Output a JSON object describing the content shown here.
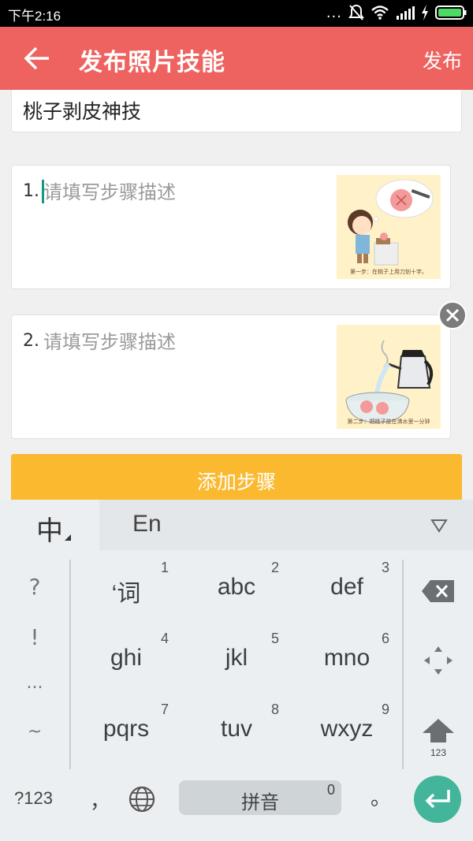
{
  "status_bar": {
    "time": "下午2:16",
    "dots": "...",
    "icons": [
      "mute-icon",
      "wifi-icon",
      "signal-icon",
      "charging-icon",
      "battery-icon"
    ]
  },
  "app_bar": {
    "title": "发布照片技能",
    "publish_label": "发布",
    "back_icon": "back-arrow-icon"
  },
  "skill_title": "桃子剥皮神技",
  "steps": [
    {
      "number": "1.",
      "placeholder": "请填写步骤描述",
      "image_caption": "第一步：在桃子上用刀划十字。"
    },
    {
      "number": "2.",
      "placeholder": "请填写步骤描述",
      "image_caption": "第二步：把桃子放在沸水里一分钟"
    }
  ],
  "add_step_label": "添加步骤",
  "keyboard": {
    "lang_zh": "中",
    "lang_en": "En",
    "side_keys": [
      "?",
      "!",
      "...",
      "~"
    ],
    "keys": [
      {
        "label": "‘词",
        "sub": "1"
      },
      {
        "label": "abc",
        "sub": "2"
      },
      {
        "label": "def",
        "sub": "3"
      },
      {
        "label": "ghi",
        "sub": "4"
      },
      {
        "label": "jkl",
        "sub": "5"
      },
      {
        "label": "mno",
        "sub": "6"
      },
      {
        "label": "pqrs",
        "sub": "7"
      },
      {
        "label": "tuv",
        "sub": "8"
      },
      {
        "label": "wxyz",
        "sub": "9"
      }
    ],
    "shift_label": "123",
    "symbols_label": "?123",
    "comma": "，",
    "space_label": "拼音",
    "space_sub": "0",
    "period": "。"
  },
  "colors": {
    "app_bar": "#ee6360",
    "add_button": "#fbb930",
    "enter_button": "#43b59a",
    "cursor": "#149a84"
  }
}
